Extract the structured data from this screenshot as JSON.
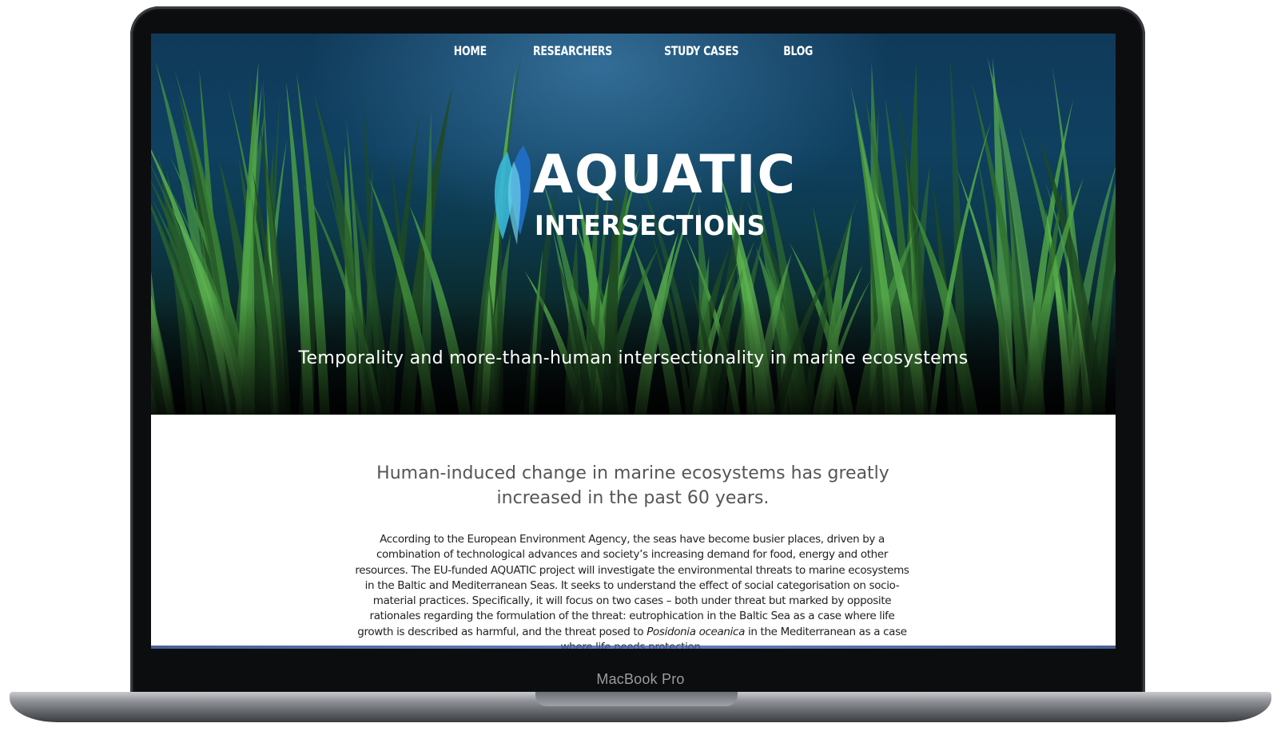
{
  "nav": {
    "items": [
      {
        "label": "HOME"
      },
      {
        "label": "RESEARCHERS"
      },
      {
        "label": "STUDY CASES"
      },
      {
        "label": "BLOG"
      }
    ]
  },
  "logo": {
    "word1": "AQUATIC",
    "word2": "INTERSECTIONS",
    "icon": "wave-mark-icon"
  },
  "hero": {
    "tagline": "Temporality and more-than-human intersectionality in marine ecosystems"
  },
  "content": {
    "headline": "Human-induced change in marine ecosystems has greatly increased in the past 60 years.",
    "body_before": "According to the European Environment Agency, the seas have become busier places, driven by a combination of technological advances and society’s increasing demand for food, energy and other resources. The EU-funded AQUATIC project will investigate the environmental threats to marine ecosystems in the Baltic and Mediterranean Seas. It seeks to understand the effect of social categorisation on socio-material practices. Specifically, it will focus on two cases – both under threat but marked by opposite rationales regarding the formulation of the threat: eutrophication in the Baltic Sea as a case where life growth is described as harmful, and the threat posed to ",
    "body_italic": "Posidonia oceanica",
    "body_after": " in the Mediterranean as a case where life needs protection."
  },
  "device": {
    "label": "MacBook Pro"
  },
  "colors": {
    "hero_top": "#103a5a",
    "grass": "#3f8a3a",
    "logo_cyan": "#3ab7d8",
    "logo_blue": "#1f6fc4"
  }
}
